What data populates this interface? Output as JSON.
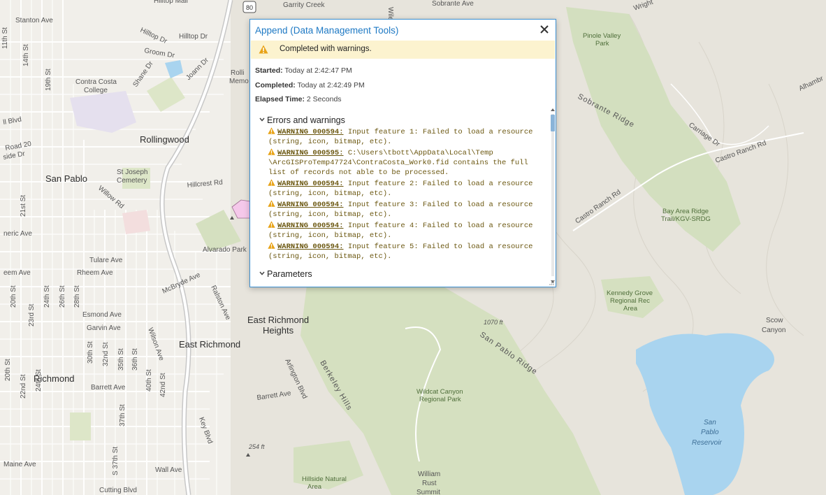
{
  "dialog": {
    "title": "Append (Data Management Tools)",
    "status": "Completed with warnings.",
    "started_label": "Started:",
    "started_value": "Today at 2:42:47 PM",
    "completed_label": "Completed:",
    "completed_value": "Today at 2:42:49 PM",
    "elapsed_label": "Elapsed Time:",
    "elapsed_value": "2 Seconds",
    "errors_section": "Errors and warnings",
    "parameters_section": "Parameters",
    "warnings": [
      {
        "code": "WARNING 000594:",
        "line1": " Input feature 1: Failed to load a resource",
        "line2": "(string, icon, bitmap, etc).",
        "line3": "",
        "line4": ""
      },
      {
        "code": "WARNING 000595:",
        "line1": " C:\\Users\\tbott\\AppData\\Local\\Temp",
        "line2": "\\ArcGISProTemp47724\\ContraCosta_Work0.fid contains the full",
        "line3": "list of records not able to be processed.",
        "line4": ""
      },
      {
        "code": "WARNING 000594:",
        "line1": " Input feature 2: Failed to load a resource",
        "line2": "(string, icon, bitmap, etc).",
        "line3": "",
        "line4": ""
      },
      {
        "code": "WARNING 000594:",
        "line1": " Input feature 3: Failed to load a resource",
        "line2": "(string, icon, bitmap, etc).",
        "line3": "",
        "line4": ""
      },
      {
        "code": "WARNING 000594:",
        "line1": " Input feature 4: Failed to load a resource",
        "line2": "(string, icon, bitmap, etc).",
        "line3": "",
        "line4": ""
      },
      {
        "code": "WARNING 000594:",
        "line1": " Input feature 5: Failed to load a resource",
        "line2": "(string, icon, bitmap, etc).",
        "line3": "",
        "line4": ""
      }
    ],
    "colors": {
      "accent": "#1e79c4",
      "warning_bg": "#fcf3cf",
      "warning_icon": "#e8a317",
      "warning_text": "#6b5710"
    }
  },
  "map": {
    "cities": [
      "San Pablo",
      "Rollingwood",
      "Richmond",
      "East Richmond",
      "East Richmond Heights"
    ],
    "places": [
      "Contra Costa College",
      "St Joseph Cemetery",
      "Alvarado Park",
      "Hillside Natural Area",
      "Wildcat Canyon Regional Park",
      "Kennedy Grove Regional Rec Area",
      "Bay Area Ridge Trail/KGV-SRDG",
      "Pinole Valley Park",
      "Scow Canyon",
      "San Pablo Reservoir",
      "William Rust Summit",
      "Hilltop Mall",
      "Richmond Memorial"
    ],
    "streets": [
      "Stanton Ave",
      "Hilltop Dr",
      "Groom Dr",
      "Shane Dr",
      "Joann Dr",
      "Road 20",
      "Hillcrest Rd",
      "Willow Rd",
      "Tulare Ave",
      "Rheem Ave",
      "McBryde Ave",
      "Ralston Ave",
      "Esmond Ave",
      "Garvin Ave",
      "Wilson Ave",
      "Barrett Ave",
      "Arlington Blvd",
      "Key Blvd",
      "Wall Ave",
      "Cutting Blvd",
      "Castro Ranch Rd",
      "Carriage Dr",
      "Sobrante Ave",
      "Garrity Creek",
      "Wright Ave",
      "Alhambra",
      "11th St",
      "14th St",
      "19th St",
      "21st St",
      "20th St",
      "22nd St",
      "23rd St",
      "24th St",
      "26th St",
      "28th St",
      "30th St",
      "32nd St",
      "35th St",
      "36th St",
      "37th St",
      "40th St",
      "42nd St",
      "S 37th St",
      "Maine Ave",
      "Wiley Way"
    ],
    "ridges": [
      "Sobrante Ridge",
      "San Pablo Ridge",
      "Berkeley Hills"
    ],
    "elevations": [
      "1070 ft",
      "254 ft"
    ],
    "highway_shield": "80"
  }
}
